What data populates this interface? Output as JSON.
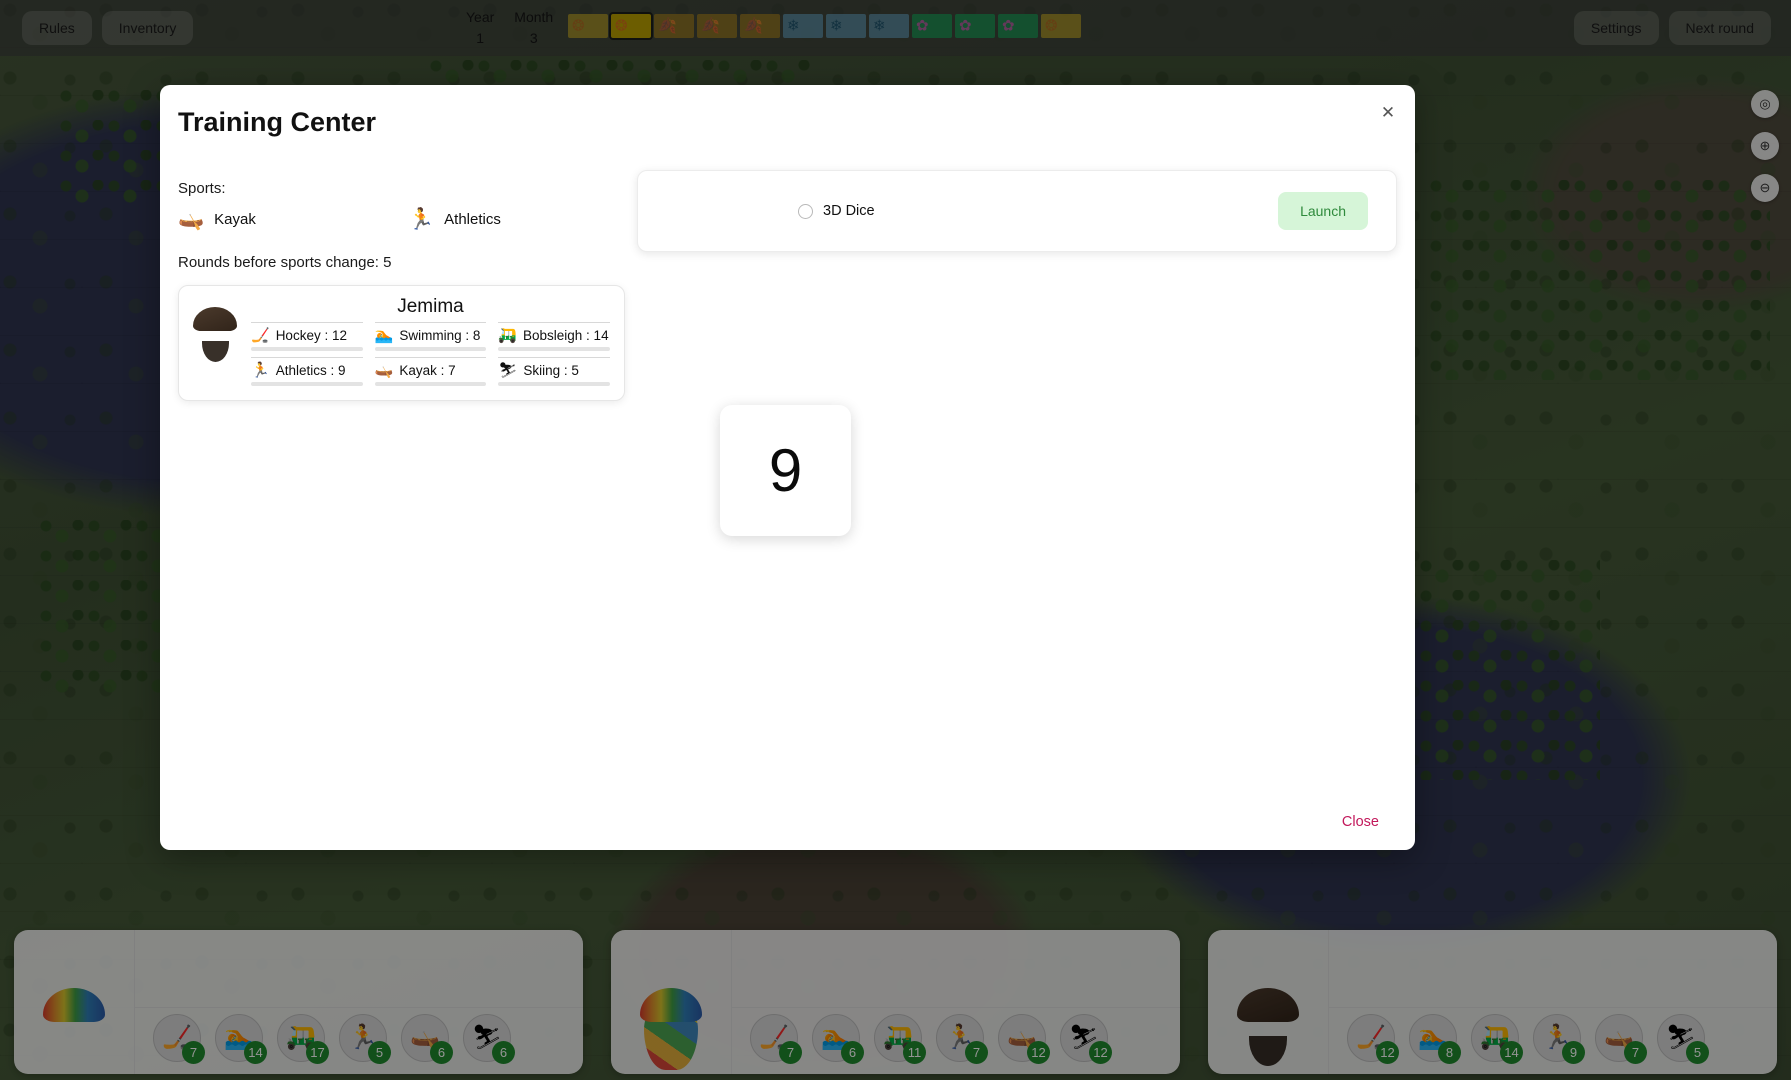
{
  "topbar": {
    "rules_label": "Rules",
    "inventory_label": "Inventory",
    "year_label": "Year",
    "year_value": "1",
    "month_label": "Month",
    "month_value": "3",
    "settings_label": "Settings",
    "next_round_label": "Next round",
    "calendar": [
      {
        "season": "autumn-early",
        "color": "#b09a28",
        "icon": "❂",
        "icon_color": "#c8761f",
        "current": false
      },
      {
        "season": "autumn-early",
        "color": "#bba000",
        "icon": "❂",
        "icon_color": "#d4711a",
        "current": true
      },
      {
        "season": "autumn",
        "color": "#9a7a23",
        "icon": "🍂",
        "icon_color": "#a83c2a",
        "current": false
      },
      {
        "season": "autumn",
        "color": "#9a7a23",
        "icon": "🍂",
        "icon_color": "#a83c2a",
        "current": false
      },
      {
        "season": "autumn",
        "color": "#9a7a23",
        "icon": "🍂",
        "icon_color": "#a83c2a",
        "current": false
      },
      {
        "season": "winter",
        "color": "#5f91a8",
        "icon": "❄",
        "icon_color": "#1d5b7a",
        "current": false
      },
      {
        "season": "winter",
        "color": "#5f91a8",
        "icon": "❄",
        "icon_color": "#1d5b7a",
        "current": false
      },
      {
        "season": "winter",
        "color": "#5f91a8",
        "icon": "❄",
        "icon_color": "#1d5b7a",
        "current": false
      },
      {
        "season": "spring",
        "color": "#1f9b57",
        "icon": "✿",
        "icon_color": "#c76bb5",
        "current": false
      },
      {
        "season": "spring",
        "color": "#1f9b57",
        "icon": "✿",
        "icon_color": "#c76bb5",
        "current": false
      },
      {
        "season": "spring",
        "color": "#1f9b57",
        "icon": "✿",
        "icon_color": "#c76bb5",
        "current": false
      },
      {
        "season": "summer",
        "color": "#b09a28",
        "icon": "❂",
        "icon_color": "#c8761f",
        "current": false
      }
    ]
  },
  "map_controls": [
    {
      "name": "locate-icon",
      "glyph": "◎"
    },
    {
      "name": "zoom-in-icon",
      "glyph": "⊕"
    },
    {
      "name": "zoom-out-icon",
      "glyph": "⊖"
    }
  ],
  "modal": {
    "title": "Training Center",
    "close_icon": "✕",
    "close_label": "Close",
    "sports_label": "Sports:",
    "sports": [
      {
        "name": "Kayak",
        "glyph": "🛶"
      },
      {
        "name": "Athletics",
        "glyph": "🏃"
      }
    ],
    "rounds_line": "Rounds before sports change: 5",
    "athlete": {
      "name": "Jemima",
      "stats": [
        {
          "sport": "Hockey",
          "label": "Hockey : 12",
          "value": 12,
          "glyph": "🏒"
        },
        {
          "sport": "Swimming",
          "label": "Swimming : 8",
          "value": 8,
          "glyph": "🏊"
        },
        {
          "sport": "Bobsleigh",
          "label": "Bobsleigh : 14",
          "value": 14,
          "glyph": "🛺"
        },
        {
          "sport": "Athletics",
          "label": "Athletics : 9",
          "value": 9,
          "glyph": "🏃"
        },
        {
          "sport": "Kayak",
          "label": "Kayak : 7",
          "value": 7,
          "glyph": "🛶"
        },
        {
          "sport": "Skiing",
          "label": "Skiing : 5",
          "value": 5,
          "glyph": "⛷"
        }
      ]
    },
    "dice": {
      "toggle_label": "3D Dice",
      "toggle_checked": false,
      "launch_label": "Launch",
      "result_value": "9"
    }
  },
  "dock": {
    "players": [
      {
        "avatar": "rainbow-hair",
        "badges": [
          {
            "sport": "Hockey",
            "glyph": "🏒",
            "level": "7"
          },
          {
            "sport": "Swimming",
            "glyph": "🏊",
            "level": "14"
          },
          {
            "sport": "Bobsleigh",
            "glyph": "🛺",
            "level": "17"
          },
          {
            "sport": "Athletics",
            "glyph": "🏃",
            "level": "5"
          },
          {
            "sport": "Kayak",
            "glyph": "🛶",
            "level": "6"
          },
          {
            "sport": "Skiing",
            "glyph": "⛷",
            "level": "6"
          }
        ]
      },
      {
        "avatar": "painted-face",
        "badges": [
          {
            "sport": "Hockey",
            "glyph": "🏒",
            "level": "7"
          },
          {
            "sport": "Swimming",
            "glyph": "🏊",
            "level": "6"
          },
          {
            "sport": "Bobsleigh",
            "glyph": "🛺",
            "level": "11"
          },
          {
            "sport": "Athletics",
            "glyph": "🏃",
            "level": "7"
          },
          {
            "sport": "Kayak",
            "glyph": "🛶",
            "level": "12"
          },
          {
            "sport": "Skiing",
            "glyph": "⛷",
            "level": "12"
          }
        ]
      },
      {
        "avatar": "bearded",
        "badges": [
          {
            "sport": "Hockey",
            "glyph": "🏒",
            "level": "12"
          },
          {
            "sport": "Swimming",
            "glyph": "🏊",
            "level": "8"
          },
          {
            "sport": "Bobsleigh",
            "glyph": "🛺",
            "level": "14"
          },
          {
            "sport": "Athletics",
            "glyph": "🏃",
            "level": "9"
          },
          {
            "sport": "Kayak",
            "glyph": "🛶",
            "level": "7"
          },
          {
            "sport": "Skiing",
            "glyph": "⛷",
            "level": "5"
          }
        ]
      }
    ]
  },
  "colors": {
    "accent_green": "#1f8b2e",
    "launch_bg": "#d6f5d8",
    "launch_fg": "#2f8a3c",
    "close_link": "#c2185b"
  }
}
